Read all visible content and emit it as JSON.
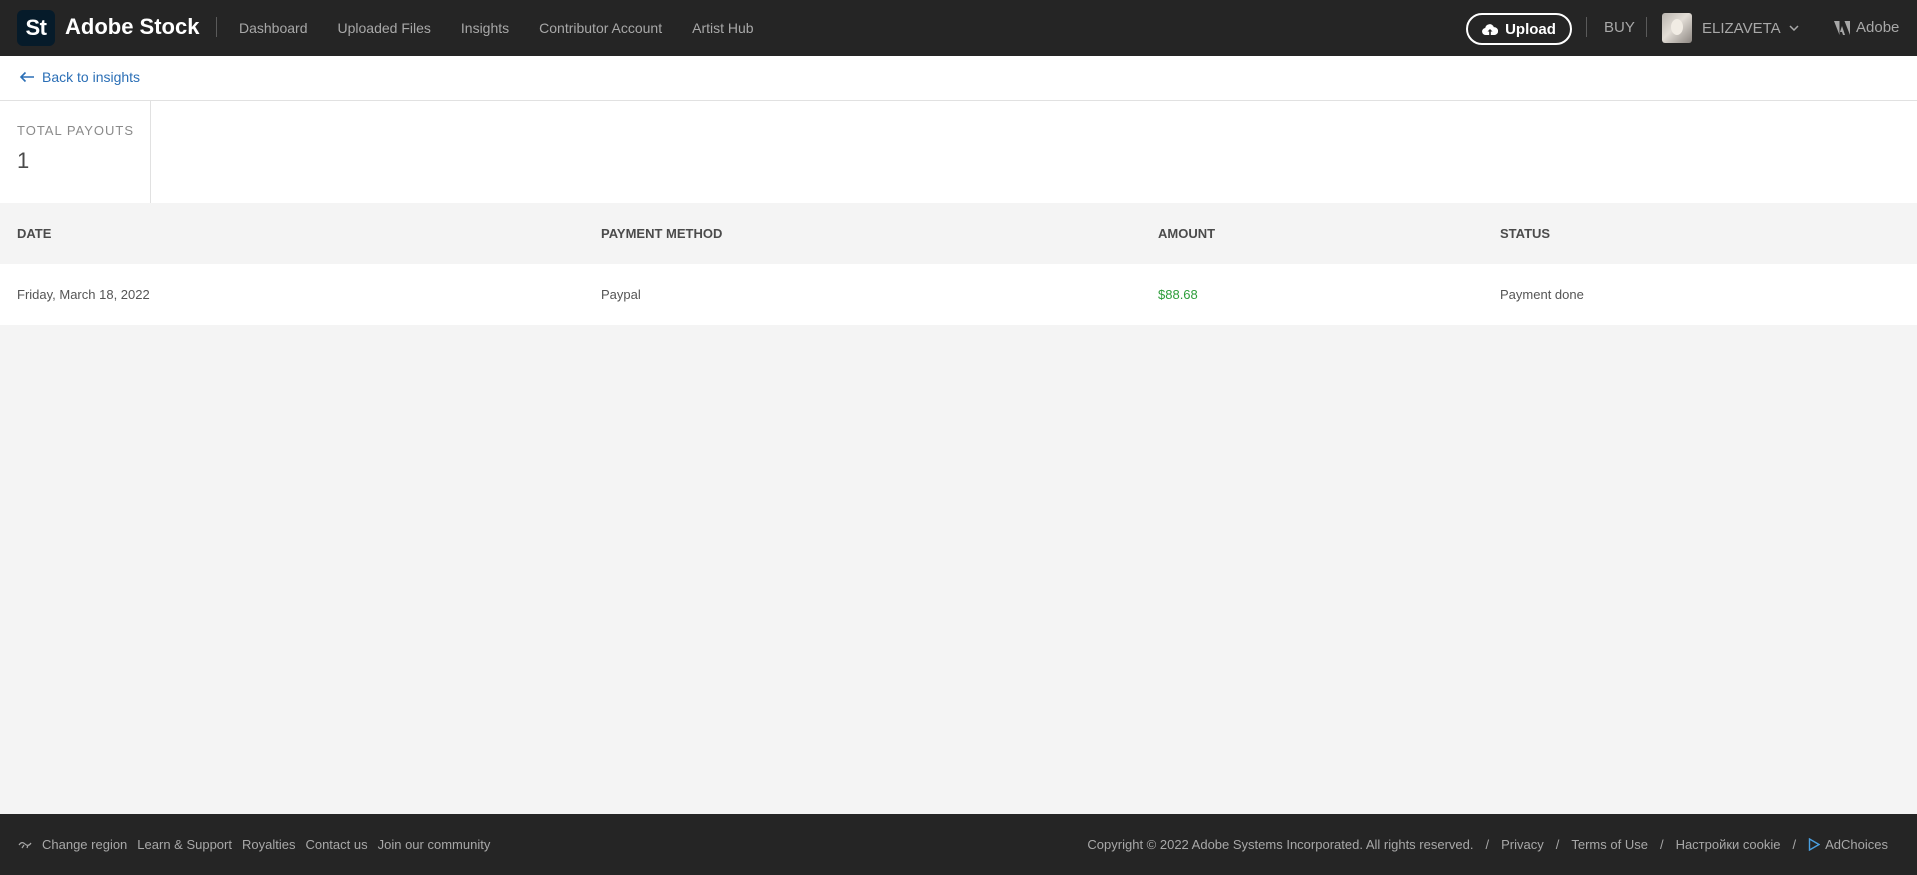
{
  "header": {
    "logo_text": "St",
    "brand": "Adobe Stock",
    "nav": [
      "Dashboard",
      "Uploaded Files",
      "Insights",
      "Contributor Account",
      "Artist Hub"
    ],
    "upload_label": "Upload",
    "buy_label": "BUY",
    "user_name": "ELIZAVETA",
    "adobe_label": "Adobe"
  },
  "back": {
    "label": "Back to insights"
  },
  "summary": {
    "label": "TOTAL PAYOUTS",
    "value": "1"
  },
  "table": {
    "columns": [
      "DATE",
      "PAYMENT METHOD",
      "AMOUNT",
      "STATUS"
    ],
    "rows": [
      {
        "date": "Friday, March 18, 2022",
        "method": "Paypal",
        "amount": "$88.68",
        "status": "Payment done"
      }
    ]
  },
  "footer": {
    "left": [
      "Change region",
      "Learn & Support",
      "Royalties",
      "Contact us",
      "Join our community"
    ],
    "copyright": "Copyright © 2022 Adobe Systems Incorporated. All rights reserved.",
    "right": [
      "Privacy",
      "Terms of Use",
      "Настройки cookie",
      "AdChoices"
    ],
    "separator": "/"
  },
  "colors": {
    "topbar": "#252525",
    "link": "#2b6fb6",
    "amount": "#2d9d3a",
    "background": "#f4f4f4"
  },
  "icons": [
    "cloud-upload-icon",
    "chevron-down-icon",
    "adobe-logo-icon",
    "arrow-left-icon",
    "globe-icon",
    "adchoices-icon"
  ]
}
